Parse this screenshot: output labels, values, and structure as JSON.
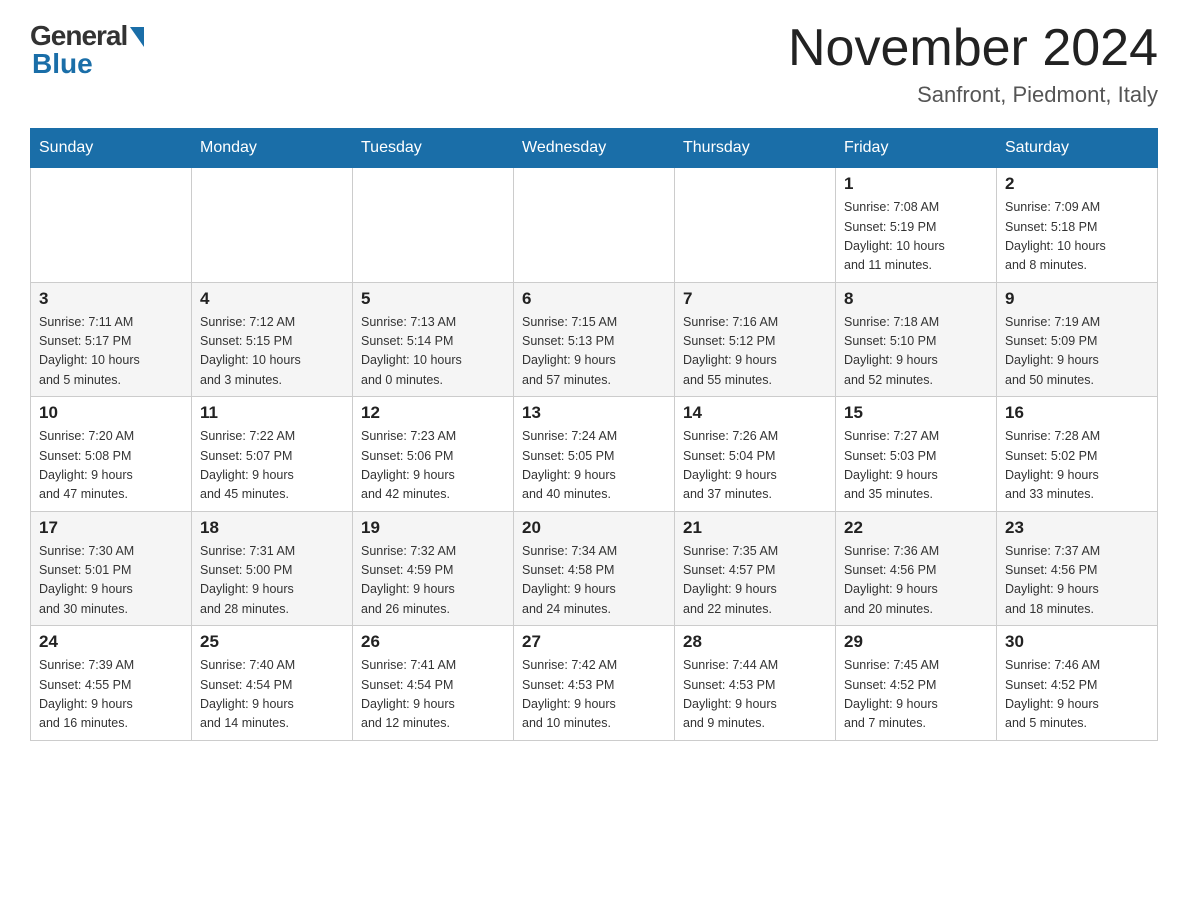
{
  "header": {
    "logo_general": "General",
    "logo_blue": "Blue",
    "month_title": "November 2024",
    "location": "Sanfront, Piedmont, Italy"
  },
  "days_of_week": [
    "Sunday",
    "Monday",
    "Tuesday",
    "Wednesday",
    "Thursday",
    "Friday",
    "Saturday"
  ],
  "weeks": [
    [
      {
        "day": "",
        "info": ""
      },
      {
        "day": "",
        "info": ""
      },
      {
        "day": "",
        "info": ""
      },
      {
        "day": "",
        "info": ""
      },
      {
        "day": "",
        "info": ""
      },
      {
        "day": "1",
        "info": "Sunrise: 7:08 AM\nSunset: 5:19 PM\nDaylight: 10 hours\nand 11 minutes."
      },
      {
        "day": "2",
        "info": "Sunrise: 7:09 AM\nSunset: 5:18 PM\nDaylight: 10 hours\nand 8 minutes."
      }
    ],
    [
      {
        "day": "3",
        "info": "Sunrise: 7:11 AM\nSunset: 5:17 PM\nDaylight: 10 hours\nand 5 minutes."
      },
      {
        "day": "4",
        "info": "Sunrise: 7:12 AM\nSunset: 5:15 PM\nDaylight: 10 hours\nand 3 minutes."
      },
      {
        "day": "5",
        "info": "Sunrise: 7:13 AM\nSunset: 5:14 PM\nDaylight: 10 hours\nand 0 minutes."
      },
      {
        "day": "6",
        "info": "Sunrise: 7:15 AM\nSunset: 5:13 PM\nDaylight: 9 hours\nand 57 minutes."
      },
      {
        "day": "7",
        "info": "Sunrise: 7:16 AM\nSunset: 5:12 PM\nDaylight: 9 hours\nand 55 minutes."
      },
      {
        "day": "8",
        "info": "Sunrise: 7:18 AM\nSunset: 5:10 PM\nDaylight: 9 hours\nand 52 minutes."
      },
      {
        "day": "9",
        "info": "Sunrise: 7:19 AM\nSunset: 5:09 PM\nDaylight: 9 hours\nand 50 minutes."
      }
    ],
    [
      {
        "day": "10",
        "info": "Sunrise: 7:20 AM\nSunset: 5:08 PM\nDaylight: 9 hours\nand 47 minutes."
      },
      {
        "day": "11",
        "info": "Sunrise: 7:22 AM\nSunset: 5:07 PM\nDaylight: 9 hours\nand 45 minutes."
      },
      {
        "day": "12",
        "info": "Sunrise: 7:23 AM\nSunset: 5:06 PM\nDaylight: 9 hours\nand 42 minutes."
      },
      {
        "day": "13",
        "info": "Sunrise: 7:24 AM\nSunset: 5:05 PM\nDaylight: 9 hours\nand 40 minutes."
      },
      {
        "day": "14",
        "info": "Sunrise: 7:26 AM\nSunset: 5:04 PM\nDaylight: 9 hours\nand 37 minutes."
      },
      {
        "day": "15",
        "info": "Sunrise: 7:27 AM\nSunset: 5:03 PM\nDaylight: 9 hours\nand 35 minutes."
      },
      {
        "day": "16",
        "info": "Sunrise: 7:28 AM\nSunset: 5:02 PM\nDaylight: 9 hours\nand 33 minutes."
      }
    ],
    [
      {
        "day": "17",
        "info": "Sunrise: 7:30 AM\nSunset: 5:01 PM\nDaylight: 9 hours\nand 30 minutes."
      },
      {
        "day": "18",
        "info": "Sunrise: 7:31 AM\nSunset: 5:00 PM\nDaylight: 9 hours\nand 28 minutes."
      },
      {
        "day": "19",
        "info": "Sunrise: 7:32 AM\nSunset: 4:59 PM\nDaylight: 9 hours\nand 26 minutes."
      },
      {
        "day": "20",
        "info": "Sunrise: 7:34 AM\nSunset: 4:58 PM\nDaylight: 9 hours\nand 24 minutes."
      },
      {
        "day": "21",
        "info": "Sunrise: 7:35 AM\nSunset: 4:57 PM\nDaylight: 9 hours\nand 22 minutes."
      },
      {
        "day": "22",
        "info": "Sunrise: 7:36 AM\nSunset: 4:56 PM\nDaylight: 9 hours\nand 20 minutes."
      },
      {
        "day": "23",
        "info": "Sunrise: 7:37 AM\nSunset: 4:56 PM\nDaylight: 9 hours\nand 18 minutes."
      }
    ],
    [
      {
        "day": "24",
        "info": "Sunrise: 7:39 AM\nSunset: 4:55 PM\nDaylight: 9 hours\nand 16 minutes."
      },
      {
        "day": "25",
        "info": "Sunrise: 7:40 AM\nSunset: 4:54 PM\nDaylight: 9 hours\nand 14 minutes."
      },
      {
        "day": "26",
        "info": "Sunrise: 7:41 AM\nSunset: 4:54 PM\nDaylight: 9 hours\nand 12 minutes."
      },
      {
        "day": "27",
        "info": "Sunrise: 7:42 AM\nSunset: 4:53 PM\nDaylight: 9 hours\nand 10 minutes."
      },
      {
        "day": "28",
        "info": "Sunrise: 7:44 AM\nSunset: 4:53 PM\nDaylight: 9 hours\nand 9 minutes."
      },
      {
        "day": "29",
        "info": "Sunrise: 7:45 AM\nSunset: 4:52 PM\nDaylight: 9 hours\nand 7 minutes."
      },
      {
        "day": "30",
        "info": "Sunrise: 7:46 AM\nSunset: 4:52 PM\nDaylight: 9 hours\nand 5 minutes."
      }
    ]
  ]
}
